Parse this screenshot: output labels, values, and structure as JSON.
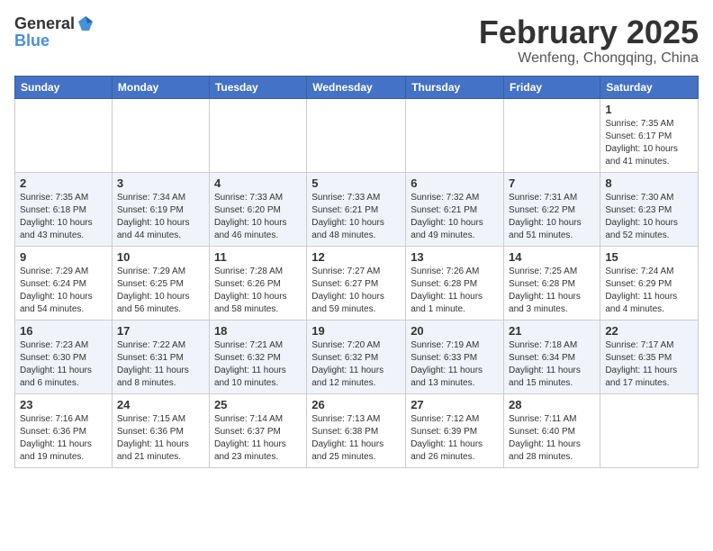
{
  "header": {
    "logo_general": "General",
    "logo_blue": "Blue",
    "title": "February 2025",
    "subtitle": "Wenfeng, Chongqing, China"
  },
  "weekdays": [
    "Sunday",
    "Monday",
    "Tuesday",
    "Wednesday",
    "Thursday",
    "Friday",
    "Saturday"
  ],
  "weeks": [
    [
      {
        "day": "",
        "info": ""
      },
      {
        "day": "",
        "info": ""
      },
      {
        "day": "",
        "info": ""
      },
      {
        "day": "",
        "info": ""
      },
      {
        "day": "",
        "info": ""
      },
      {
        "day": "",
        "info": ""
      },
      {
        "day": "1",
        "info": "Sunrise: 7:35 AM\nSunset: 6:17 PM\nDaylight: 10 hours and 41 minutes."
      }
    ],
    [
      {
        "day": "2",
        "info": "Sunrise: 7:35 AM\nSunset: 6:18 PM\nDaylight: 10 hours and 43 minutes."
      },
      {
        "day": "3",
        "info": "Sunrise: 7:34 AM\nSunset: 6:19 PM\nDaylight: 10 hours and 44 minutes."
      },
      {
        "day": "4",
        "info": "Sunrise: 7:33 AM\nSunset: 6:20 PM\nDaylight: 10 hours and 46 minutes."
      },
      {
        "day": "5",
        "info": "Sunrise: 7:33 AM\nSunset: 6:21 PM\nDaylight: 10 hours and 48 minutes."
      },
      {
        "day": "6",
        "info": "Sunrise: 7:32 AM\nSunset: 6:21 PM\nDaylight: 10 hours and 49 minutes."
      },
      {
        "day": "7",
        "info": "Sunrise: 7:31 AM\nSunset: 6:22 PM\nDaylight: 10 hours and 51 minutes."
      },
      {
        "day": "8",
        "info": "Sunrise: 7:30 AM\nSunset: 6:23 PM\nDaylight: 10 hours and 52 minutes."
      }
    ],
    [
      {
        "day": "9",
        "info": "Sunrise: 7:29 AM\nSunset: 6:24 PM\nDaylight: 10 hours and 54 minutes."
      },
      {
        "day": "10",
        "info": "Sunrise: 7:29 AM\nSunset: 6:25 PM\nDaylight: 10 hours and 56 minutes."
      },
      {
        "day": "11",
        "info": "Sunrise: 7:28 AM\nSunset: 6:26 PM\nDaylight: 10 hours and 58 minutes."
      },
      {
        "day": "12",
        "info": "Sunrise: 7:27 AM\nSunset: 6:27 PM\nDaylight: 10 hours and 59 minutes."
      },
      {
        "day": "13",
        "info": "Sunrise: 7:26 AM\nSunset: 6:28 PM\nDaylight: 11 hours and 1 minute."
      },
      {
        "day": "14",
        "info": "Sunrise: 7:25 AM\nSunset: 6:28 PM\nDaylight: 11 hours and 3 minutes."
      },
      {
        "day": "15",
        "info": "Sunrise: 7:24 AM\nSunset: 6:29 PM\nDaylight: 11 hours and 4 minutes."
      }
    ],
    [
      {
        "day": "16",
        "info": "Sunrise: 7:23 AM\nSunset: 6:30 PM\nDaylight: 11 hours and 6 minutes."
      },
      {
        "day": "17",
        "info": "Sunrise: 7:22 AM\nSunset: 6:31 PM\nDaylight: 11 hours and 8 minutes."
      },
      {
        "day": "18",
        "info": "Sunrise: 7:21 AM\nSunset: 6:32 PM\nDaylight: 11 hours and 10 minutes."
      },
      {
        "day": "19",
        "info": "Sunrise: 7:20 AM\nSunset: 6:32 PM\nDaylight: 11 hours and 12 minutes."
      },
      {
        "day": "20",
        "info": "Sunrise: 7:19 AM\nSunset: 6:33 PM\nDaylight: 11 hours and 13 minutes."
      },
      {
        "day": "21",
        "info": "Sunrise: 7:18 AM\nSunset: 6:34 PM\nDaylight: 11 hours and 15 minutes."
      },
      {
        "day": "22",
        "info": "Sunrise: 7:17 AM\nSunset: 6:35 PM\nDaylight: 11 hours and 17 minutes."
      }
    ],
    [
      {
        "day": "23",
        "info": "Sunrise: 7:16 AM\nSunset: 6:36 PM\nDaylight: 11 hours and 19 minutes."
      },
      {
        "day": "24",
        "info": "Sunrise: 7:15 AM\nSunset: 6:36 PM\nDaylight: 11 hours and 21 minutes."
      },
      {
        "day": "25",
        "info": "Sunrise: 7:14 AM\nSunset: 6:37 PM\nDaylight: 11 hours and 23 minutes."
      },
      {
        "day": "26",
        "info": "Sunrise: 7:13 AM\nSunset: 6:38 PM\nDaylight: 11 hours and 25 minutes."
      },
      {
        "day": "27",
        "info": "Sunrise: 7:12 AM\nSunset: 6:39 PM\nDaylight: 11 hours and 26 minutes."
      },
      {
        "day": "28",
        "info": "Sunrise: 7:11 AM\nSunset: 6:40 PM\nDaylight: 11 hours and 28 minutes."
      },
      {
        "day": "",
        "info": ""
      }
    ]
  ]
}
